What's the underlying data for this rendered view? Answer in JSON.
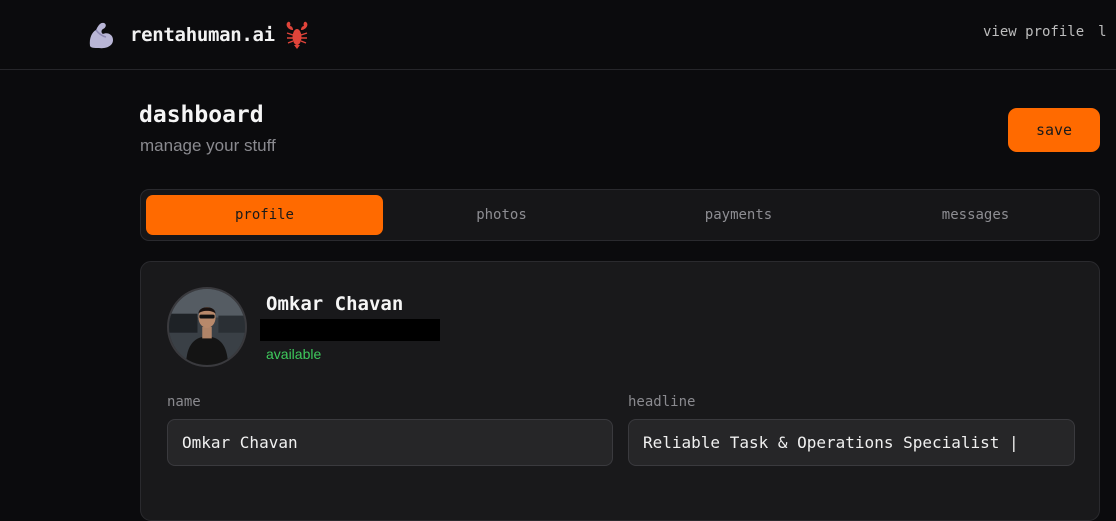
{
  "brand": {
    "name": "rentahuman.ai",
    "logo_icon": "flexed-arm-icon",
    "badge_icon": "lobster-icon"
  },
  "topnav": {
    "items": [
      "view profile",
      "l"
    ]
  },
  "header": {
    "title": "dashboard",
    "subtitle": "manage your stuff",
    "save_label": "save"
  },
  "tabs": [
    {
      "label": "profile",
      "active": true
    },
    {
      "label": "photos",
      "active": false
    },
    {
      "label": "payments",
      "active": false
    },
    {
      "label": "messages",
      "active": false
    }
  ],
  "profile": {
    "name": "Omkar Chavan",
    "status": "available",
    "status_color": "#3ec95c"
  },
  "form": {
    "name_label": "name",
    "name_value": "Omkar Chavan",
    "headline_label": "headline",
    "headline_value": "Reliable Task & Operations Specialist |"
  },
  "colors": {
    "accent": "#ff6a00",
    "background": "#0b0b0d",
    "card": "#19191b"
  }
}
